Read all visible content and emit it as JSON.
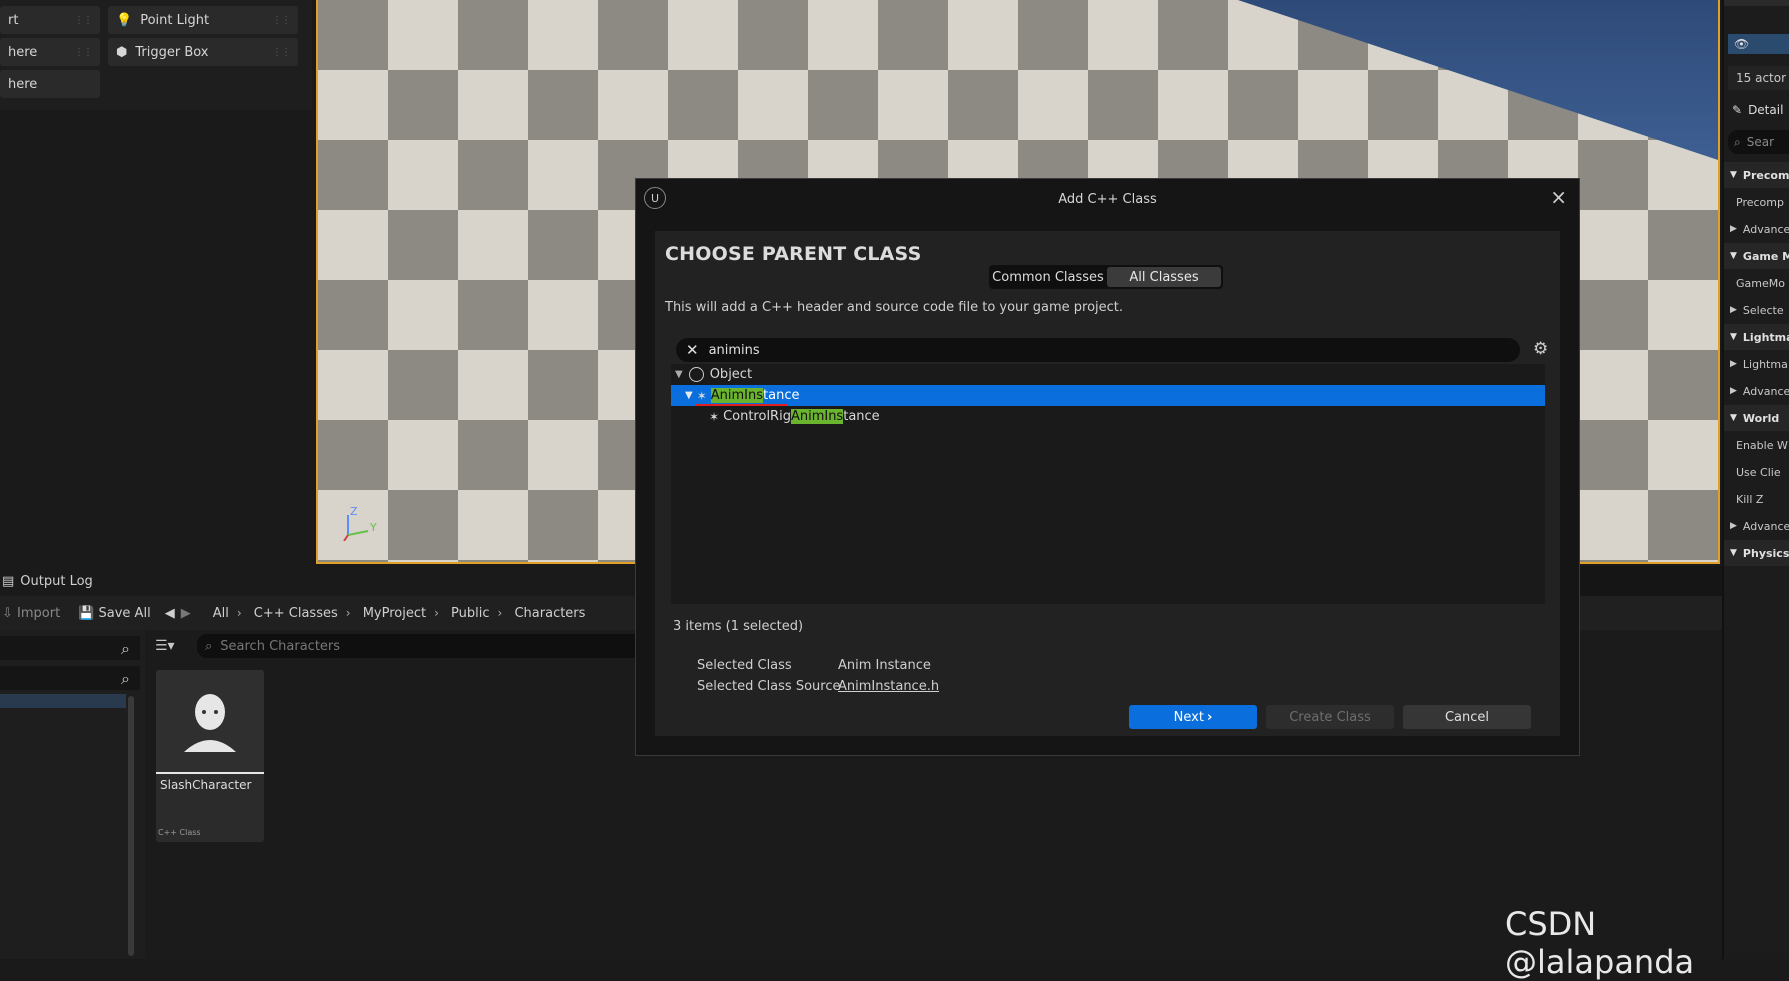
{
  "left_panel": {
    "items": [
      {
        "label": "rt"
      },
      {
        "label": "here"
      },
      {
        "label": "Point Light"
      },
      {
        "label": "Trigger Box"
      }
    ]
  },
  "viewport": {
    "axis_z": "Z",
    "axis_y": "Y"
  },
  "right_panel": {
    "actors": "15 actor",
    "details_tab": "Detail",
    "search_placeholder": "Sear",
    "rows": [
      {
        "label": "Precomp",
        "header": true
      },
      {
        "label": "Precomp",
        "header": false
      },
      {
        "label": "Advance",
        "header": false
      },
      {
        "label": "Game M",
        "header": true
      },
      {
        "label": "GameMo",
        "header": false
      },
      {
        "label": "Selecte",
        "header": false
      },
      {
        "label": "Lightma",
        "header": true
      },
      {
        "label": "Lightma",
        "header": false
      },
      {
        "label": "Advance",
        "header": false
      },
      {
        "label": "World",
        "header": true
      },
      {
        "label": "Enable W",
        "header": false
      },
      {
        "label": "Use Clie",
        "header": false
      },
      {
        "label": "Kill Z",
        "header": false
      },
      {
        "label": "Advance",
        "header": false
      },
      {
        "label": "Physics",
        "header": true
      }
    ]
  },
  "bottom": {
    "output_log": "Output Log",
    "import": "Import",
    "save_all": "Save All",
    "breadcrumbs": [
      "All",
      "C++ Classes",
      "MyProject",
      "Public",
      "Characters"
    ],
    "search_placeholder": "Search Characters",
    "asset": {
      "name": "SlashCharacter",
      "type": "C++ Class"
    }
  },
  "dialog": {
    "title": "Add C++ Class",
    "heading": "CHOOSE PARENT CLASS",
    "tabs": [
      "Common Classes",
      "All Classes"
    ],
    "active_tab": "All Classes",
    "description": "This will add a C++ header and source code file to your game project.",
    "search_value": "animins",
    "tree": {
      "root": "Object",
      "selected_pre": "",
      "selected_hl": "AnimIns",
      "selected_post": "tance",
      "child_pre": "ControlRig",
      "child_hl": "AnimIns",
      "child_post": "tance"
    },
    "items_count": "3 items (1 selected)",
    "selected_class_label": "Selected Class",
    "selected_class_value": "Anim Instance",
    "selected_source_label": "Selected Class Source",
    "selected_source_value": "AnimInstance.h",
    "buttons": {
      "next": "Next",
      "create": "Create Class",
      "cancel": "Cancel"
    }
  },
  "watermark": "CSDN @lalapanda",
  "colors": {
    "accent": "#0a6fdd",
    "highlight": "#6ab42e",
    "viewport_border": "#e0a02a"
  }
}
